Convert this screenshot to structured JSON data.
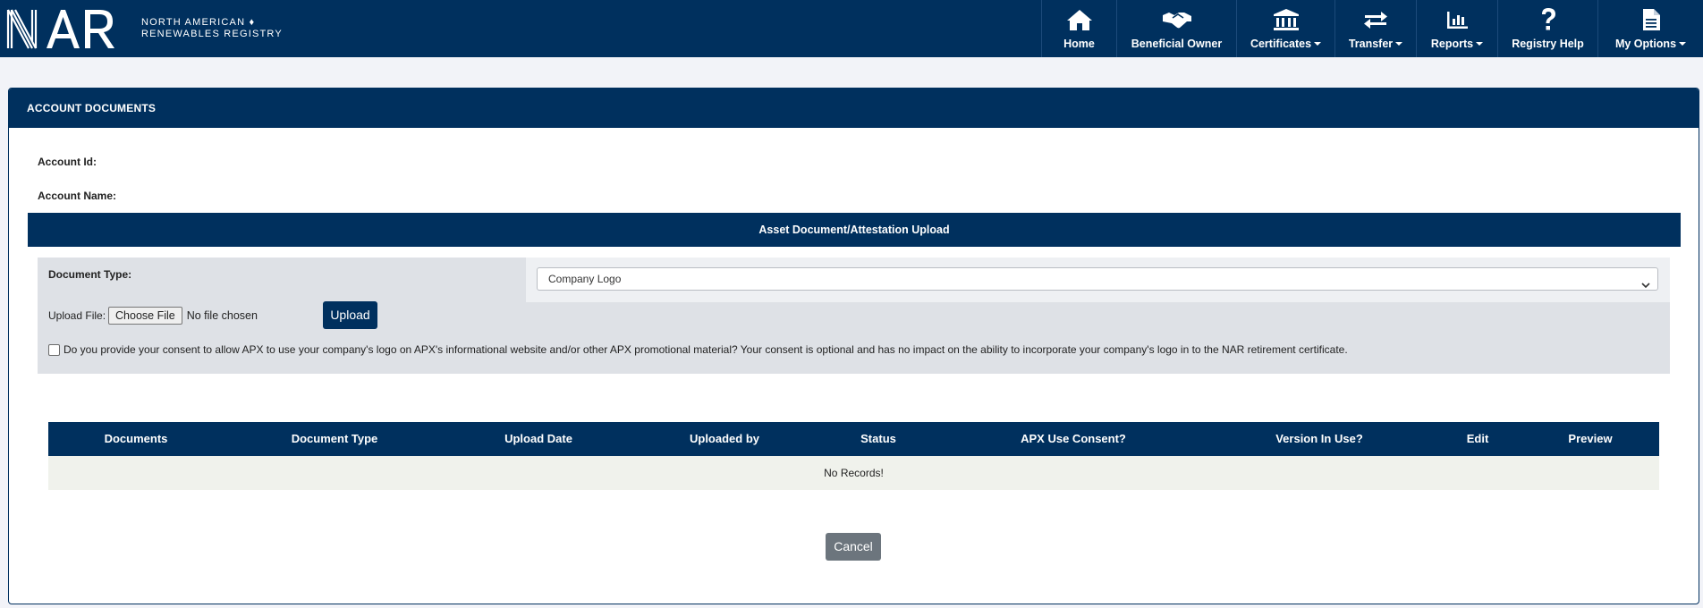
{
  "brand": {
    "logo_letters": "NAR",
    "line1": "NORTH AMERICAN",
    "line2": "RENEWABLES REGISTRY"
  },
  "nav": {
    "home": "Home",
    "beneficial_owner": "Beneficial Owner",
    "certificates": "Certificates",
    "transfer": "Transfer",
    "reports": "Reports",
    "registry_help": "Registry Help",
    "my_options": "My Options"
  },
  "panel": {
    "title": "ACCOUNT DOCUMENTS",
    "account_id_label": "Account Id:",
    "account_id_value": "",
    "account_name_label": "Account Name:",
    "account_name_value": ""
  },
  "upload": {
    "section_title": "Asset Document/Attestation Upload",
    "document_type_label": "Document Type:",
    "document_type_selected": "Company Logo",
    "upload_file_label": "Upload File:",
    "choose_file_label": "Choose File",
    "no_file_text": "No file chosen",
    "upload_button": "Upload",
    "consent_checked": false,
    "consent_text": "Do you provide your consent to allow APX to use your company's logo on APX's informational website and/or other APX promotional material? Your consent is optional and has no impact on the ability to incorporate your company's logo in to the NAR retirement certificate."
  },
  "table": {
    "headers": [
      "Documents",
      "Document Type",
      "Upload Date",
      "Uploaded by",
      "Status",
      "APX Use Consent?",
      "Version In Use?",
      "Edit",
      "Preview"
    ],
    "empty_text": "No Records!"
  },
  "cancel_button": "Cancel",
  "colors": {
    "primary": "#00305e",
    "cancel": "#6c757d",
    "upload_box": "#dee1e6",
    "empty_row": "#f0f2ec"
  }
}
